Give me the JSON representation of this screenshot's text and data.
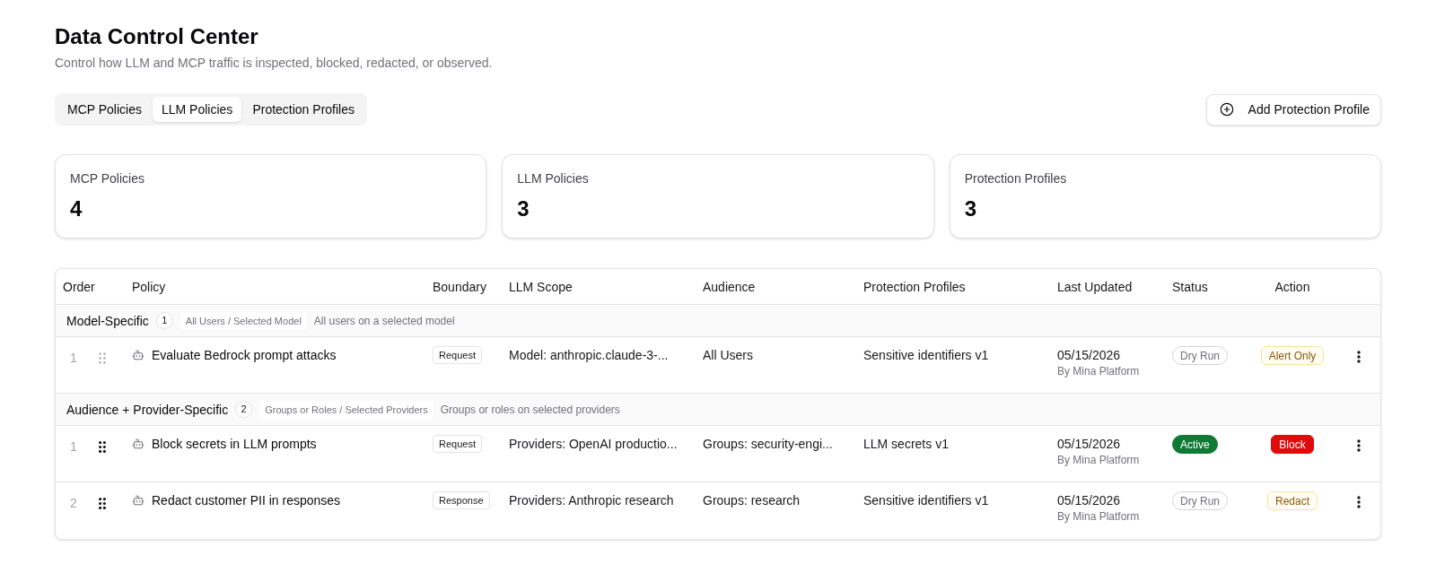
{
  "header": {
    "title": "Data Control Center",
    "subtitle": "Control how LLM and MCP traffic is inspected, blocked, redacted, or observed."
  },
  "tabs": [
    {
      "label": "MCP Policies",
      "selected": false
    },
    {
      "label": "LLM Policies",
      "selected": true
    },
    {
      "label": "Protection Profiles",
      "selected": false
    }
  ],
  "add_button": {
    "label": "Add Protection Profile"
  },
  "stats": [
    {
      "label": "MCP Policies",
      "value": "4"
    },
    {
      "label": "LLM Policies",
      "value": "3"
    },
    {
      "label": "Protection Profiles",
      "value": "3"
    }
  ],
  "table": {
    "columns": [
      "Order",
      "Policy",
      "Boundary",
      "LLM Scope",
      "Audience",
      "Protection Profiles",
      "Last Updated",
      "Status",
      "Action"
    ],
    "groups": [
      {
        "name": "Model-Specific",
        "count": "1",
        "scope": "All Users / Selected Model",
        "description": "All users on a selected model",
        "rows": [
          {
            "order": "1",
            "drag_enabled": false,
            "policy": "Evaluate Bedrock prompt attacks",
            "boundary": "Request",
            "llm_scope": "Model: anthropic.claude-3-...",
            "audience": "All Users",
            "protection_profiles": "Sensitive identifiers v1",
            "last_updated": "05/15/2026",
            "updated_by": "By Mina Platform",
            "status": {
              "label": "Dry Run",
              "kind": "dryrun"
            },
            "action": {
              "label": "Alert Only",
              "kind": "alert"
            }
          }
        ]
      },
      {
        "name": "Audience + Provider-Specific",
        "count": "2",
        "scope": "Groups or Roles / Selected Providers",
        "description": "Groups or roles on selected providers",
        "rows": [
          {
            "order": "1",
            "drag_enabled": true,
            "policy": "Block secrets in LLM prompts",
            "boundary": "Request",
            "llm_scope": "Providers: OpenAI productio...",
            "audience": "Groups: security-engi...",
            "protection_profiles": "LLM secrets v1",
            "last_updated": "05/15/2026",
            "updated_by": "By Mina Platform",
            "status": {
              "label": "Active",
              "kind": "active"
            },
            "action": {
              "label": "Block",
              "kind": "block"
            }
          },
          {
            "order": "2",
            "drag_enabled": true,
            "policy": "Redact customer PII in responses",
            "boundary": "Response",
            "llm_scope": "Providers: Anthropic research",
            "audience": "Groups: research",
            "protection_profiles": "Sensitive identifiers v1",
            "last_updated": "05/15/2026",
            "updated_by": "By Mina Platform",
            "status": {
              "label": "Dry Run",
              "kind": "dryrun"
            },
            "action": {
              "label": "Redact",
              "kind": "redact"
            }
          }
        ]
      }
    ]
  }
}
